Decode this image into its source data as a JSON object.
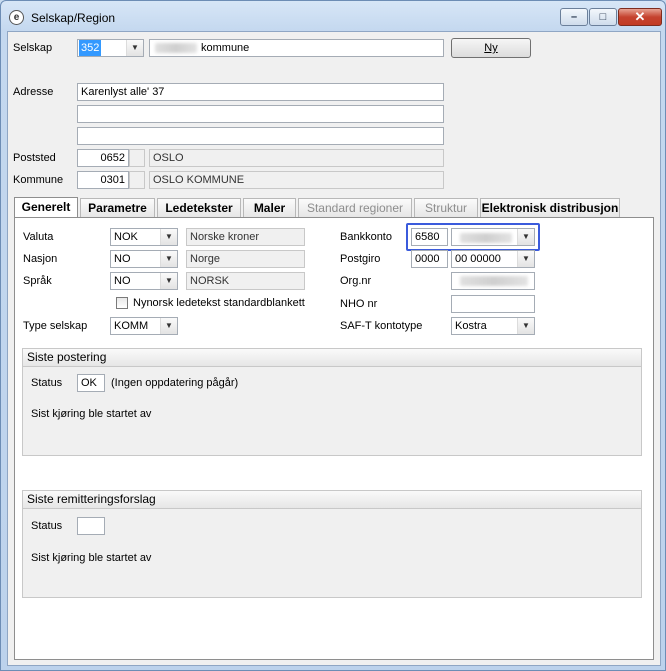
{
  "window": {
    "title": "Selskap/Region",
    "controls": {
      "minimize": "–",
      "maximize": "□",
      "close": "✕"
    }
  },
  "header": {
    "selskap_label": "Selskap",
    "selskap_value": "352",
    "selskap_name_suffix": "kommune",
    "ny_button": "Ny",
    "adresse_label": "Adresse",
    "adresse_lines": [
      "Karenlyst alle' 37",
      "",
      ""
    ],
    "poststed_label": "Poststed",
    "poststed_code": "0652",
    "poststed_name": "OSLO",
    "kommune_label": "Kommune",
    "kommune_code": "0301",
    "kommune_name": "OSLO KOMMUNE"
  },
  "tabs": [
    {
      "label": "Generelt",
      "state": "active"
    },
    {
      "label": "Parametre",
      "state": "normal"
    },
    {
      "label": "Ledetekster",
      "state": "normal"
    },
    {
      "label": "Maler",
      "state": "normal"
    },
    {
      "label": "Standard regioner",
      "state": "disabled"
    },
    {
      "label": "Struktur",
      "state": "disabled"
    },
    {
      "label": "Elektronisk distribusjon",
      "state": "normal"
    }
  ],
  "general": {
    "valuta_label": "Valuta",
    "valuta_code": "NOK",
    "valuta_name": "Norske kroner",
    "nasjon_label": "Nasjon",
    "nasjon_code": "NO",
    "nasjon_name": "Norge",
    "sprak_label": "Språk",
    "sprak_code": "NO",
    "sprak_name": "NORSK",
    "nynorsk_checkbox_label": "Nynorsk ledetekst standardblankett",
    "type_selskap_label": "Type selskap",
    "type_selskap_value": "KOMM",
    "bankkonto_label": "Bankkonto",
    "bankkonto_prefix": "6580",
    "postgiro_label": "Postgiro",
    "postgiro_prefix": "0000",
    "postgiro_suffix": "00 00000",
    "orgnr_label": "Org.nr",
    "nho_label": "NHO nr",
    "saft_label": "SAF-T kontotype",
    "saft_value": "Kostra"
  },
  "siste_postering": {
    "title": "Siste postering",
    "status_label": "Status",
    "status_value": "OK",
    "status_text": "(Ingen oppdatering pågår)",
    "started_by_label": "Sist kjøring ble startet av"
  },
  "siste_remittering": {
    "title": "Siste remitteringsforslag",
    "status_label": "Status",
    "status_value": "",
    "started_by_label": "Sist kjøring ble startet av"
  }
}
